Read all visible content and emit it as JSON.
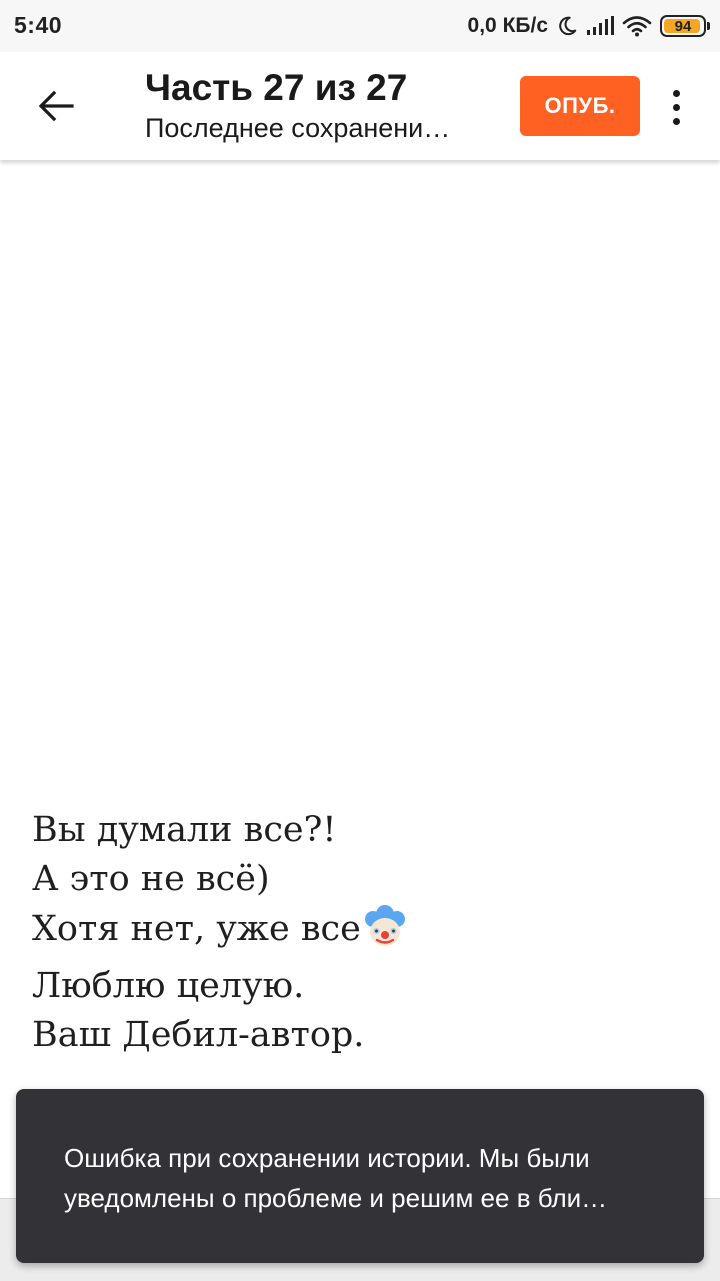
{
  "status_bar": {
    "time": "5:40",
    "network_speed": "0,0 КБ/с",
    "battery_level": "94",
    "battery_fraction": 0.94,
    "icons": [
      "moon-icon",
      "signal-icon",
      "wifi-icon",
      "battery-icon"
    ]
  },
  "app_bar": {
    "title": "Часть 27 из 27",
    "subtitle": "Последнее сохранени…",
    "publish_label": "ОПУБ.",
    "publish_color": "#ff6122",
    "back_icon": "arrow-left-icon",
    "more_icon": "more-vert-icon"
  },
  "story": {
    "lines": [
      "Вы думали все?!",
      "А это не всё)",
      "Хотя нет, уже все",
      "Люблю целую.",
      "Ваш Дебил-автор."
    ],
    "emoji_icon": "clown-face-icon"
  },
  "snackbar": {
    "lines": [
      "Ошибка при сохранении истории. Мы были",
      "уведомлены о проблеме и решим ее в бли…"
    ],
    "background": "#333236"
  }
}
